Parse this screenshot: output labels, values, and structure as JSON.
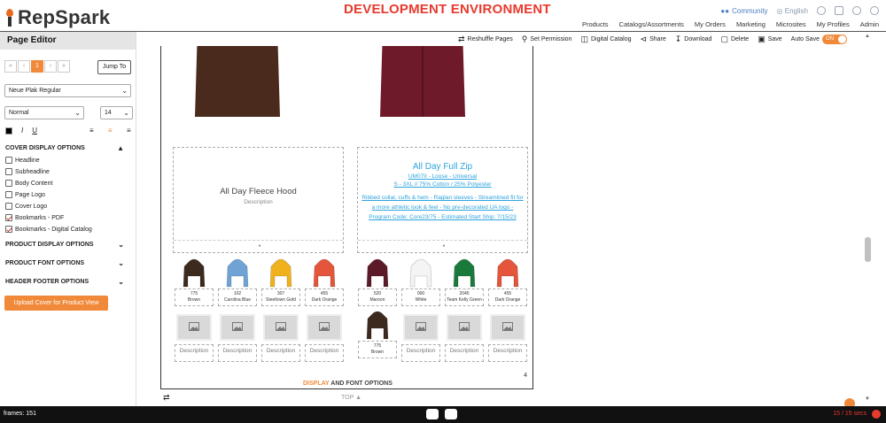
{
  "header": {
    "logo_text": "RepSpark",
    "environment_banner": "DEVELOPMENT ENVIRONMENT",
    "community_label": "Community",
    "language_label": "English",
    "nav": [
      "Products",
      "Catalogs/Assortments",
      "My Orders",
      "Marketing",
      "Microsites",
      "My Profiles",
      "Admin"
    ]
  },
  "left_panel": {
    "title": "Page Editor",
    "pager": {
      "first": "«",
      "prev": "‹",
      "current": "1",
      "next": "›",
      "last": "»"
    },
    "jump_label": "Jump To",
    "font_family": "Neue Plak Regular",
    "font_weight": "Normal",
    "font_size": "14",
    "italic_label": "I",
    "underline_label": "U",
    "cover_display_heading": "COVER DISPLAY OPTIONS",
    "cover_options": [
      {
        "label": "Headline",
        "checked": false
      },
      {
        "label": "Subheadline",
        "checked": false
      },
      {
        "label": "Body Content",
        "checked": false
      },
      {
        "label": "Page Logo",
        "checked": false
      },
      {
        "label": "Cover Logo",
        "checked": false
      },
      {
        "label": "Bookmarks - PDF",
        "checked": true
      },
      {
        "label": "Bookmarks - Digital Catalog",
        "checked": true
      }
    ],
    "product_display_heading": "PRODUCT DISPLAY OPTIONS",
    "product_font_heading": "PRODUCT FONT OPTIONS",
    "header_footer_heading": "HEADER FOOTER OPTIONS",
    "upload_button": "Upload Cover for Product View"
  },
  "toolbar": {
    "reshuffle": "Reshuffle Pages",
    "set_permission": "Set Permission",
    "digital_catalog": "Digital Catalog",
    "share": "Share",
    "download": "Download",
    "delete": "Delete",
    "save": "Save",
    "auto_save_label": "Auto Save",
    "auto_save_state": "ON"
  },
  "canvas": {
    "left_product": {
      "title": "All Day Fleece Hood",
      "description": "Description",
      "colors": [
        {
          "code": "775",
          "name": "Brown",
          "color": "#3b2a1d"
        },
        {
          "code": "102",
          "name": "Carolina Blue",
          "color": "#6fa3d6"
        },
        {
          "code": "307",
          "name": "Steeltown Gold",
          "color": "#f0b21c"
        },
        {
          "code": "455",
          "name": "Dark Orange",
          "color": "#e4553b"
        }
      ],
      "placeholder_descs": [
        "Description",
        "Description",
        "Description",
        "Description"
      ]
    },
    "right_product": {
      "title": "All Day Full Zip",
      "line1": "UM07II - Loose - Universal",
      "line2": "S - 3XL // 75% Cotton / 25% Polyester",
      "body": "Ribbed collar, cuffs & hem - Raglan sleeves - Streamlined fit for a more athletic look & feel - No pre-decorated UA logo - Program Code: Core23/75 - Estimated Start Ship: 7/15/23",
      "colors": [
        {
          "code": "520",
          "name": "Maroon",
          "color": "#5c1a28"
        },
        {
          "code": "000",
          "name": "White",
          "color": "#f4f4f4"
        },
        {
          "code": "2045",
          "name": "Team Kelly Green",
          "color": "#1a7a3c"
        },
        {
          "code": "455",
          "name": "Dark Orange",
          "color": "#e4553b"
        }
      ],
      "extra_color": {
        "code": "775",
        "name": "Brown",
        "color": "#3b2a1d"
      },
      "placeholder_descs": [
        "Description",
        "Description",
        "Description"
      ]
    },
    "hero_left_color": "#4a2a1c",
    "hero_right_color": "#6e1a2a",
    "page_number": "4"
  },
  "footer": {
    "display_label": "DISPLAY",
    "font_options_label": "AND FONT OPTIONS",
    "top_label": "TOP"
  },
  "bottom_bar": {
    "frames": "frames: 151",
    "secs": "15 / 15 secs"
  },
  "colors": {
    "accent": "#f08a3a",
    "danger": "#e83a2e",
    "link": "#2ea3dc"
  }
}
